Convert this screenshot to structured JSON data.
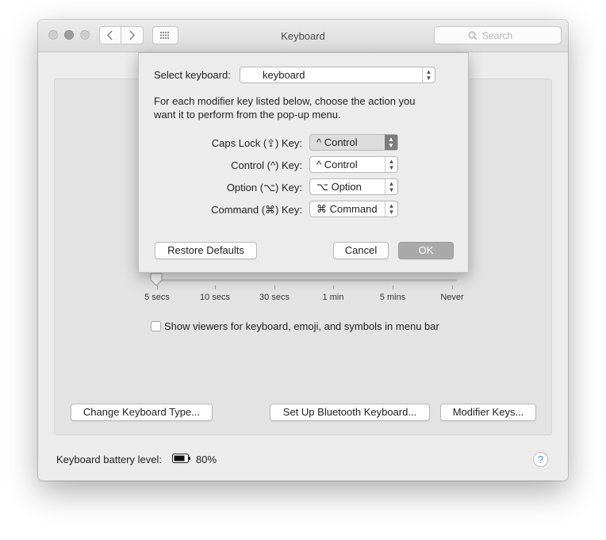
{
  "window": {
    "title": "Keyboard"
  },
  "toolbar": {
    "search_placeholder": "Search"
  },
  "sheet": {
    "select_label": "Select keyboard:",
    "selected_keyboard": "keyboard",
    "description_line1": "For each modifier key listed below, choose the action you",
    "description_line2": "want it to perform from the pop-up menu.",
    "rows": [
      {
        "label": "Caps Lock (⇪) Key:",
        "value": "^ Control"
      },
      {
        "label": "Control (^) Key:",
        "value": "^ Control"
      },
      {
        "label": "Option (⌥) Key:",
        "value": "⌥ Option"
      },
      {
        "label": "Command (⌘) Key:",
        "value": "⌘ Command"
      }
    ],
    "restore_label": "Restore Defaults",
    "cancel_label": "Cancel",
    "ok_label": "OK"
  },
  "slider": {
    "ticks": [
      "5 secs",
      "10 secs",
      "30 secs",
      "1 min",
      "5 mins",
      "Never"
    ],
    "value": "5 secs"
  },
  "checkbox": {
    "label": "Show viewers for keyboard, emoji, and symbols in menu bar",
    "checked": false
  },
  "buttons": {
    "change_type": "Change Keyboard Type...",
    "bluetooth": "Set Up Bluetooth Keyboard...",
    "modifier_keys": "Modifier Keys..."
  },
  "battery": {
    "label": "Keyboard battery level:",
    "value": "80%",
    "level": 0.8
  },
  "help": {
    "symbol": "?"
  },
  "colors": {
    "accent_help": "#3f8ee8",
    "ok_button": "#a9a9a9"
  }
}
